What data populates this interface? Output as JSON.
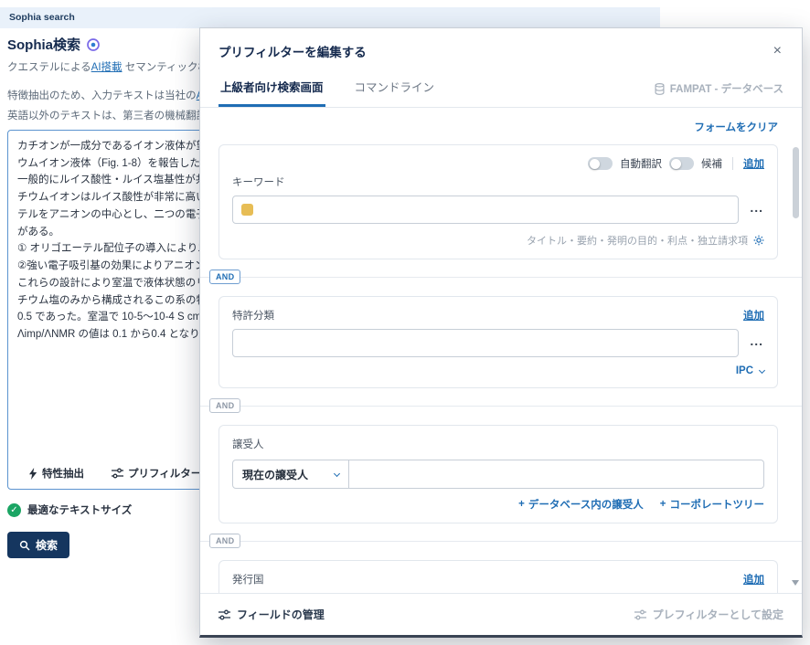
{
  "topbar": {
    "title": "Sophia search"
  },
  "panel": {
    "title": "Sophia検索",
    "intro": {
      "prefix": "クエステルによる",
      "link": "AI搭載",
      "suffix": " セマンティック検索"
    },
    "note1": {
      "prefix": "特徴抽出のため、入力テキストは当社の",
      "link": "AIプ"
    },
    "note2": "英語以外のテキストは、第三者の機械翻訳サ",
    "input_text": "カチオンが一成分であるイオン液体が望ま\nウムイオン液体（Fig. 1-8）を報告した。(\n一般的にルイス酸性・ルイス塩基性が共に\nチウムイオンはルイス酸性が非常に高いた\nテルをアニオンの中心とし、二つの電子求\nがある。\n① オリゴエーテル配位子の導入によりエー\n②強い電子吸引基の効果によりアニオン中\nこれらの設計により室温で液体状態のリチ\nチウム塩のみから構成されるこの系の特徴\n0.5 であった。室温で 10-5〜10-4 S cm-1 \nΛimp/ΛNMR の値は 0.1 から0.4 となり溶媒",
    "feature_extract_button": "特性抽出",
    "prefilter_button": "プリフィルター",
    "text_size_ok": "最適なテキストサイズ",
    "check_glyph": "✓",
    "search_button": "検索"
  },
  "modal": {
    "title": "プリフィルターを編集する",
    "close": "×",
    "tabs": {
      "advanced": "上級者向け検索画面",
      "command_line": "コマンドライン"
    },
    "database": "FAMPAT - データベース",
    "clear_form": "フォームをクリア",
    "and_label": "AND",
    "keyword": {
      "label": "キーワード",
      "auto_translate": "自動翻訳",
      "suggestions": "候補",
      "add": "追加",
      "more": "...",
      "scope": "タイトル・要約・発明の目的・利点・独立請求項"
    },
    "classification": {
      "label": "特許分類",
      "add": "追加",
      "more": "...",
      "type": "IPC"
    },
    "assignee": {
      "label": "譲受人",
      "selected": "現在の譲受人",
      "plus": "+",
      "db_link": "データベース内の譲受人",
      "tree_link": "コーポレートツリー"
    },
    "country": {
      "label": "発行国",
      "add": "追加"
    },
    "footer": {
      "manage_fields": "フィールドの管理",
      "set_as_prefilter": "プレフィルターとして設定"
    }
  }
}
